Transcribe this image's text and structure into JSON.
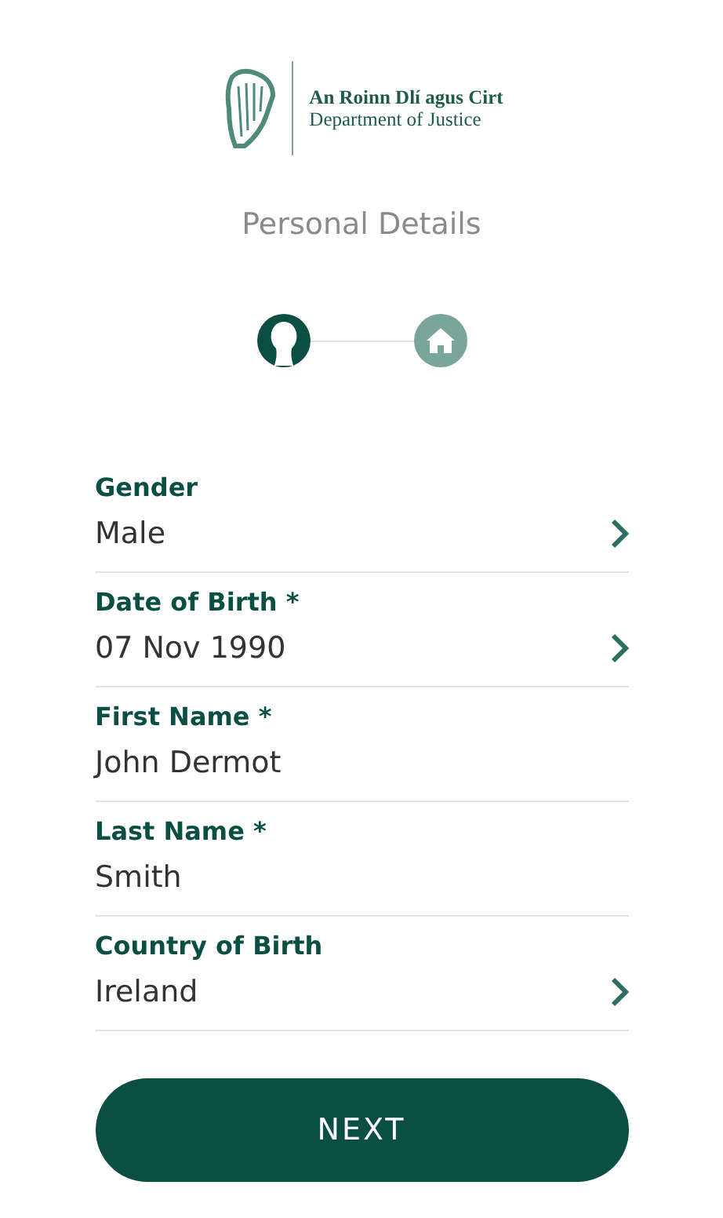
{
  "logo": {
    "irish_name": "An Roinn Dlí agus Cirt",
    "english_name": "Department of Justice"
  },
  "title": "Personal Details",
  "steps": [
    {
      "kind": "person",
      "selected": true
    },
    {
      "kind": "home",
      "selected": false
    }
  ],
  "fields": [
    {
      "label": "Gender",
      "value": "Male",
      "kind": "select"
    },
    {
      "label": "Date of Birth *",
      "value": "07 Nov 1990",
      "kind": "select"
    },
    {
      "label": "First Name *",
      "value": "John Dermot",
      "kind": "text"
    },
    {
      "label": "Last Name *",
      "value": "Smith",
      "kind": "text"
    },
    {
      "label": "Country of Birth",
      "value": "Ireland",
      "kind": "select"
    }
  ],
  "button": "NEXT"
}
